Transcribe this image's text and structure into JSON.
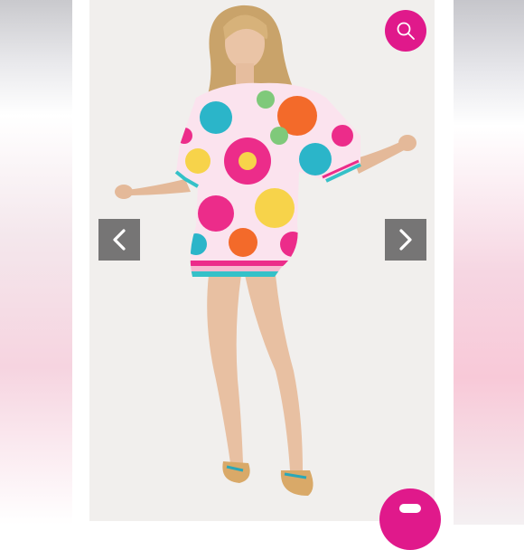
{
  "viewer": {
    "photo_alt": "",
    "prev_icon": "chevron-left-icon",
    "next_icon": "chevron-right-icon",
    "search_icon": "search-icon",
    "chat_icon": "chat-bubble-icon"
  },
  "colors": {
    "accent": "#e0198b",
    "nav_bg": "#5a5a5a",
    "photo_bg": "#f1efed"
  }
}
